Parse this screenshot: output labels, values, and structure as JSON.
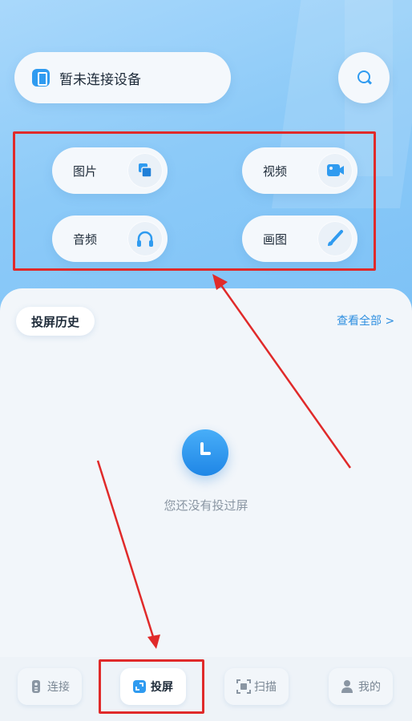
{
  "header": {
    "device_status": "暂未连接设备"
  },
  "functions": [
    {
      "label": "图片",
      "icon": "image-icon"
    },
    {
      "label": "视频",
      "icon": "video-icon"
    },
    {
      "label": "音频",
      "icon": "headphones-icon"
    },
    {
      "label": "画图",
      "icon": "brush-icon"
    }
  ],
  "history": {
    "title": "投屏历史",
    "view_all": "查看全部 >",
    "empty_text": "您还没有投过屏"
  },
  "nav": [
    {
      "label": "连接",
      "icon": "remote-icon",
      "active": false
    },
    {
      "label": "投屏",
      "icon": "cast-icon",
      "active": true
    },
    {
      "label": "扫描",
      "icon": "scan-icon",
      "active": false
    },
    {
      "label": "我的",
      "icon": "user-icon",
      "active": false
    }
  ],
  "colors": {
    "accent": "#2f9bf0",
    "annotation": "#e02a2a",
    "header_bg": "#8ccaf8"
  }
}
